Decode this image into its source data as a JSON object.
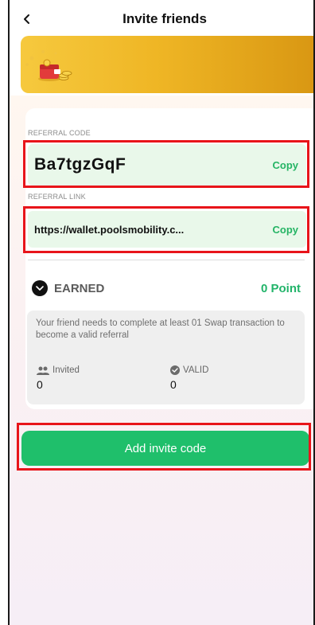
{
  "header": {
    "title": "Invite friends",
    "back_icon": "chevron-left-icon"
  },
  "referral_code": {
    "label": "REFERRAL CODE",
    "value": "Ba7tgzGqF",
    "copy_label": "Copy"
  },
  "referral_link": {
    "label": "REFERRAL LINK",
    "value": "https://wallet.poolsmobility.c...",
    "copy_label": "Copy"
  },
  "earned": {
    "label": "EARNED",
    "points": "0 Point"
  },
  "info": {
    "text": "Your friend needs to complete at least 01 Swap transaction to become a valid referral",
    "invited_label": "Invited",
    "invited_value": "0",
    "valid_label": "VALID",
    "valid_value": "0"
  },
  "actions": {
    "add_invite_label": "Add invite code"
  },
  "colors": {
    "accent": "#1fbf6b",
    "copy": "#25b464",
    "highlight": "#e8141a",
    "banner": "#efb625"
  }
}
